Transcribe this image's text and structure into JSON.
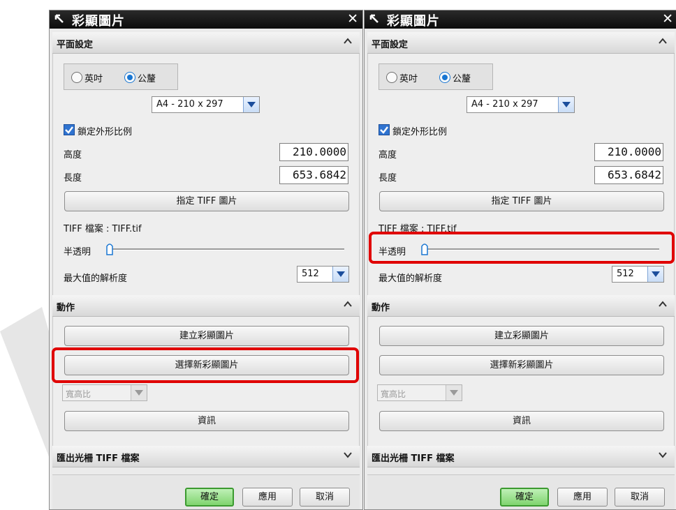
{
  "dialogs": [
    {
      "title": "彩顯圖片",
      "sections": {
        "plane": "平面設定",
        "action": "動作",
        "export": "匯出光柵 TIFF 檔案"
      },
      "units": {
        "inch": "英吋",
        "metric": "公釐",
        "selected": "metric"
      },
      "paper_size": "A4 - 210 x 297",
      "lock_ratio_label": "鎖定外形比例",
      "lock_ratio_checked": true,
      "height_label": "高度",
      "height_value": "210.0000",
      "length_label": "長度",
      "length_value": "653.6842",
      "assign_tiff_button": "指定 TIFF 圖片",
      "tiff_file_text": "TIFF 檔案 : TIFF.tif",
      "transparency_label": "半透明",
      "transparency_value": 0,
      "max_resolution_label": "最大值的解析度",
      "max_resolution_value": "512",
      "create_button": "建立彩顯圖片",
      "select_new_button": "選擇新彩顯圖片",
      "aspect_ratio_value": "寬高比",
      "info_button": "資訊",
      "ok_button": "確定",
      "apply_button": "應用",
      "cancel_button": "取消",
      "highlight": "select_new_button"
    },
    {
      "title": "彩顯圖片",
      "sections": {
        "plane": "平面設定",
        "action": "動作",
        "export": "匯出光柵 TIFF 檔案"
      },
      "units": {
        "inch": "英吋",
        "metric": "公釐",
        "selected": "metric"
      },
      "paper_size": "A4 - 210 x 297",
      "lock_ratio_label": "鎖定外形比例",
      "lock_ratio_checked": true,
      "height_label": "高度",
      "height_value": "210.0000",
      "length_label": "長度",
      "length_value": "653.6842",
      "assign_tiff_button": "指定 TIFF 圖片",
      "tiff_file_text": "TIFF 檔案 : TIFF.tif",
      "transparency_label": "半透明",
      "transparency_value": 0,
      "max_resolution_label": "最大值的解析度",
      "max_resolution_value": "512",
      "create_button": "建立彩顯圖片",
      "select_new_button": "選擇新彩顯圖片",
      "aspect_ratio_value": "寬高比",
      "info_button": "資訊",
      "ok_button": "確定",
      "apply_button": "應用",
      "cancel_button": "取消",
      "highlight": "transparency_row"
    }
  ],
  "colors": {
    "highlight": "#e00000",
    "accent": "#1976d2",
    "ok_button": "#7fd46e"
  }
}
